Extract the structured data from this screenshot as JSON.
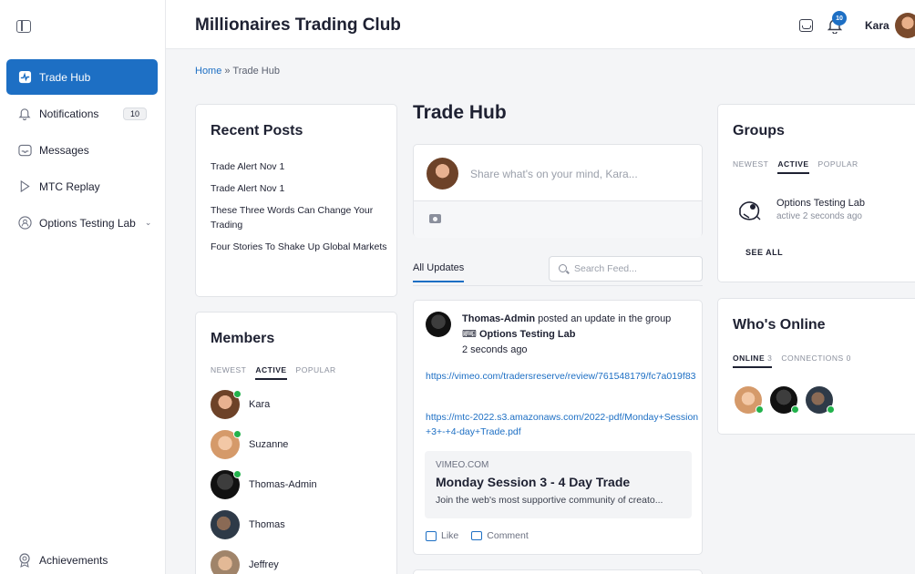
{
  "header": {
    "site_title": "Millionaires Trading Club",
    "notification_count": "10",
    "user_name": "Kara"
  },
  "sidebar": {
    "items": [
      {
        "label": "Trade Hub",
        "icon": "activity-icon",
        "active": true
      },
      {
        "label": "Notifications",
        "icon": "bell-icon",
        "badge": "10"
      },
      {
        "label": "Messages",
        "icon": "inbox-icon"
      },
      {
        "label": "MTC Replay",
        "icon": "play-icon"
      },
      {
        "label": "Options Testing Lab",
        "icon": "group-icon",
        "has_children": true
      }
    ],
    "footer_item": {
      "label": "Achievements",
      "icon": "award-icon"
    }
  },
  "breadcrumb": {
    "home": "Home",
    "separator": "»",
    "current": "Trade Hub"
  },
  "recent_posts": {
    "title": "Recent Posts",
    "items": [
      "Trade Alert Nov 1",
      "Trade Alert Nov 1",
      "These Three Words Can Change Your Trading",
      "Four Stories To Shake Up Global Markets"
    ]
  },
  "members": {
    "title": "Members",
    "tabs": [
      "NEWEST",
      "ACTIVE",
      "POPULAR"
    ],
    "active_tab": "ACTIVE",
    "list": [
      {
        "name": "Kara",
        "online": true
      },
      {
        "name": "Suzanne",
        "online": true
      },
      {
        "name": "Thomas-Admin",
        "online": true
      },
      {
        "name": "Thomas",
        "online": false
      },
      {
        "name": "Jeffrey",
        "online": false
      }
    ]
  },
  "main": {
    "page_title": "Trade Hub",
    "composer_placeholder": "Share what's on your mind, Kara...",
    "feed_tab": "All Updates",
    "search_placeholder": "Search Feed...",
    "post": {
      "author": "Thomas-Admin",
      "action_text": "posted an update in the group",
      "group": "Options Testing Lab",
      "time": "2 seconds ago",
      "link1": "https://vimeo.com/tradersreserve/review/761548179/fc7a019f83",
      "link2": "https://mtc-2022.s3.amazonaws.com/2022-pdf/Monday+Session+3+-+4-day+Trade.pdf",
      "embed": {
        "source": "VIMEO.COM",
        "title": "Monday Session 3 - 4 Day Trade",
        "description": "Join the web's most supportive community of creato..."
      },
      "like_label": "Like",
      "comment_label": "Comment"
    }
  },
  "groups": {
    "title": "Groups",
    "tabs": [
      "NEWEST",
      "ACTIVE",
      "POPULAR"
    ],
    "active_tab": "ACTIVE",
    "item": {
      "name": "Options Testing Lab",
      "status": "active 2 seconds ago"
    },
    "see_all": "SEE ALL"
  },
  "whos_online": {
    "title": "Who's Online",
    "tabs": [
      {
        "label": "ONLINE",
        "count": "3"
      },
      {
        "label": "CONNECTIONS",
        "count": "0"
      }
    ]
  },
  "colors": {
    "accent": "#1d6fc4",
    "online": "#22b24c",
    "background": "#f4f5f7"
  }
}
